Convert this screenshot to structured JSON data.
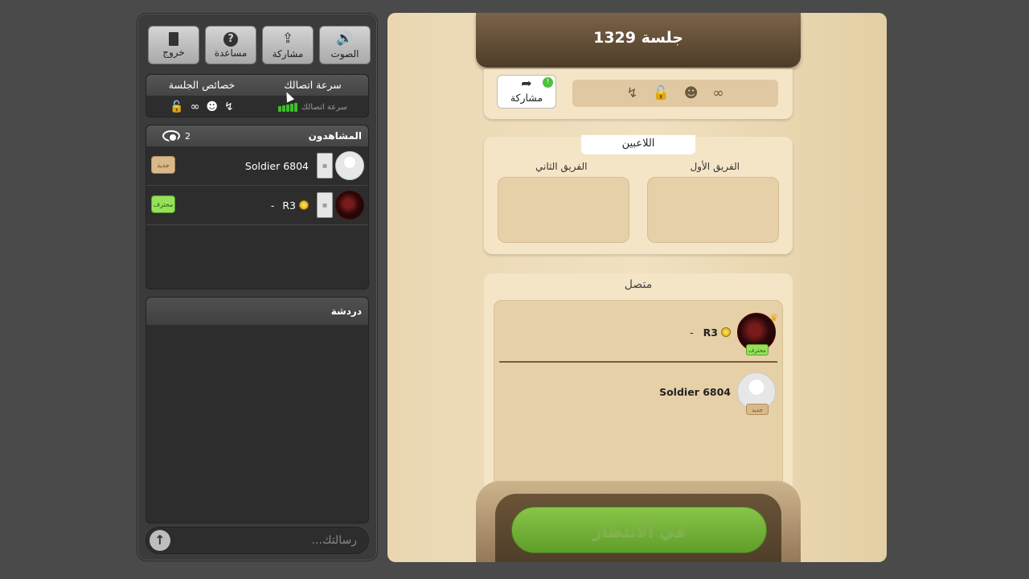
{
  "left_panel": {
    "buttons": [
      {
        "icon": "speaker-icon",
        "glyph": "🔊",
        "label": "الصوت"
      },
      {
        "icon": "share-icon",
        "glyph": "⇪",
        "label": "مشاركة"
      },
      {
        "icon": "help-icon",
        "glyph": "?",
        "label": "مساعدة"
      },
      {
        "icon": "exit-door-icon",
        "glyph": "▮",
        "label": "خروج"
      }
    ],
    "props": {
      "speed_header": "سرعة اتصالك",
      "session_props_header": "خصائص الجلسة",
      "speed_label": "سرعة اتصالك",
      "speed_color": "#3fbf2a"
    },
    "viewers": {
      "title": "المشاهدون",
      "count": "2",
      "rows": [
        {
          "name": "Soldier 6804",
          "badge": "جديد",
          "badge_type": "new",
          "avatar": "default",
          "has_coin": false
        },
        {
          "name": "R3",
          "suffix": "-",
          "badge": "محترف",
          "badge_type": "pro",
          "avatar": "dark",
          "has_coin": true
        }
      ]
    },
    "chat": {
      "title": "دردشة",
      "placeholder": "رسالتك..."
    }
  },
  "board": {
    "session_title": "جلسة 1329",
    "share_label": "مشاركة",
    "share_badge": "!",
    "players_tab": "اللاعبين",
    "team_one": "الفريق الأول",
    "team_two": "الفريق الثاني",
    "connected_title": "متصل",
    "connected": [
      {
        "name": "R3",
        "suffix": "-",
        "badge": "محترف",
        "badge_type": "pro",
        "avatar": "dark",
        "crown": true
      },
      {
        "name": "Soldier 6804",
        "badge": "جديد",
        "badge_type": "new",
        "avatar": "default",
        "crown": false
      }
    ],
    "wait_button": "في الانتظار"
  },
  "colors": {
    "accent_green": "#5f9e2a",
    "header_brown": "#4e3c28",
    "pro_badge": "#96e05a",
    "new_badge": "#d9b98a"
  }
}
